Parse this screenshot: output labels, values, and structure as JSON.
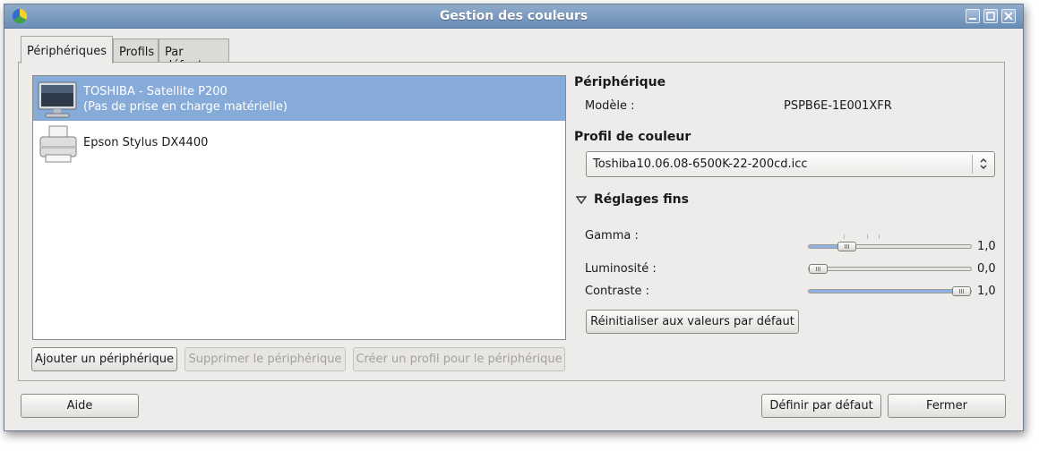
{
  "window": {
    "title": "Gestion des couleurs"
  },
  "tabs": [
    {
      "label": "Périphériques",
      "active": true
    },
    {
      "label": "Profils",
      "active": false
    },
    {
      "label": "Par défaut",
      "active": false
    }
  ],
  "devices": [
    {
      "name": "TOSHIBA - Satellite P200",
      "subtitle": "(Pas de prise en charge matérielle)",
      "icon": "monitor-icon",
      "selected": true
    },
    {
      "name": "Epson Stylus DX4400",
      "subtitle": "",
      "icon": "printer-icon",
      "selected": false
    }
  ],
  "device_actions": {
    "add": "Ajouter un périphérique",
    "remove": "Supprimer le périphérique",
    "create_profile": "Créer un profil pour le périphérique"
  },
  "details": {
    "device_heading": "Périphérique",
    "model_label": "Modèle :",
    "model_value": "PSPB6E-1E001XFR",
    "color_profile_heading": "Profil de couleur",
    "color_profile_value": "Toshiba10.06.08-6500K-22-200cd.icc",
    "fine_tuning_heading": "Réglages fins",
    "sliders": [
      {
        "label": "Gamma :",
        "value_text": "1,0",
        "level": 0.2
      },
      {
        "label": "Luminosité :",
        "value_text": "0,0",
        "level": 0.0
      },
      {
        "label": "Contraste :",
        "value_text": "1,0",
        "level": 1.0
      }
    ],
    "reset_button": "Réinitialiser aux valeurs par défaut"
  },
  "footer": {
    "help": "Aide",
    "set_default": "Définir par défaut",
    "close": "Fermer"
  },
  "colors": {
    "titlebar": "#7b9bc4",
    "selection": "#86abd9",
    "slider_fill": "#8fb2de"
  }
}
